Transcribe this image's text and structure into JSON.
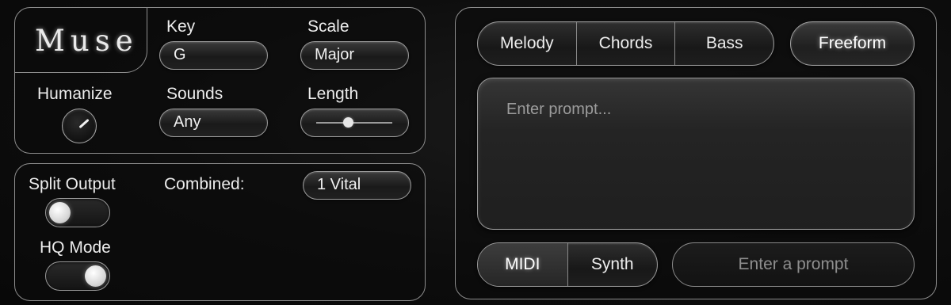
{
  "brand": {
    "logo_text": "Muse"
  },
  "controls": {
    "key": {
      "label": "Key",
      "value": "G"
    },
    "scale": {
      "label": "Scale",
      "value": "Major"
    },
    "humanize": {
      "label": "Humanize"
    },
    "sounds": {
      "label": "Sounds",
      "value": "Any"
    },
    "length": {
      "label": "Length",
      "level": 0.42
    }
  },
  "output": {
    "split_output": {
      "label": "Split Output",
      "on": false
    },
    "combined": {
      "label": "Combined:",
      "value": "1 Vital"
    },
    "hq_mode": {
      "label": "HQ Mode",
      "on": true
    }
  },
  "modes": {
    "tabs": [
      "Melody",
      "Chords",
      "Bass"
    ],
    "freeform_label": "Freeform"
  },
  "prompt": {
    "placeholder": "Enter prompt..."
  },
  "output_type": {
    "options": [
      "MIDI",
      "Synth"
    ],
    "active": "MIDI"
  },
  "generate": {
    "label": "Enter a prompt"
  }
}
